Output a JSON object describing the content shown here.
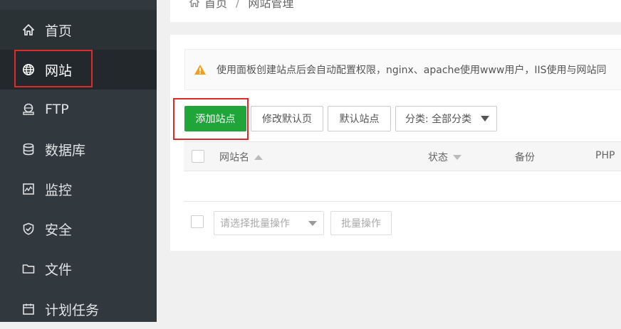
{
  "sidebar": {
    "items": [
      {
        "label": "首页",
        "icon": "home-icon"
      },
      {
        "label": "网站",
        "icon": "globe-icon",
        "active": true
      },
      {
        "label": "FTP",
        "icon": "ftp-icon"
      },
      {
        "label": "数据库",
        "icon": "database-icon"
      },
      {
        "label": "监控",
        "icon": "monitor-icon"
      },
      {
        "label": "安全",
        "icon": "shield-icon"
      },
      {
        "label": "文件",
        "icon": "folder-icon"
      },
      {
        "label": "计划任务",
        "icon": "calendar-icon"
      }
    ]
  },
  "breadcrumb": {
    "home": "首页",
    "separator": "/",
    "current": "网站管理"
  },
  "notice": {
    "text": "使用面板创建站点后会自动配置权限，nginx、apache使用www用户，IIS使用与网站同",
    "icon": "warning-icon"
  },
  "toolbar": {
    "add_site": "添加站点",
    "edit_default_page": "修改默认页",
    "default_site": "默认站点",
    "category": "分类: 全部分类"
  },
  "table": {
    "columns": [
      "网站名",
      "状态",
      "备份",
      "PHP"
    ]
  },
  "batch": {
    "select_placeholder": "请选择批量操作",
    "button": "批量操作"
  },
  "colors": {
    "sidebar_bg": "#32393e",
    "primary_green": "#20a53a",
    "annotation_red": "#e02a2a",
    "warning_orange": "#f0a020"
  }
}
